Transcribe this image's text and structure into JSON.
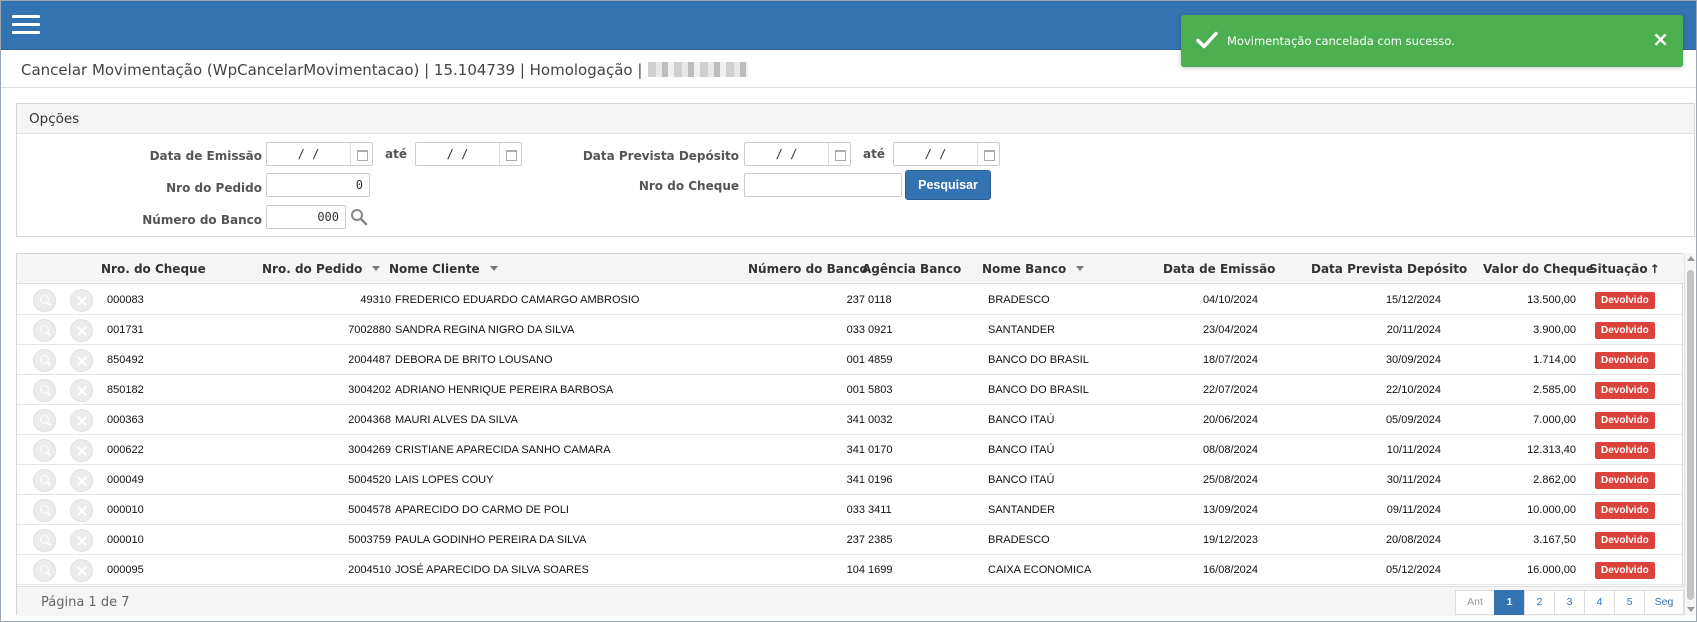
{
  "toast": {
    "message": "Movimentação cancelada com sucesso.",
    "close_label": "×",
    "color": "#4caf50"
  },
  "header": {
    "title": "Cancelar Movimentação (WpCancelarMovimentacao) | 15.104739 | Homologação |",
    "color": "#3473b1"
  },
  "options": {
    "panel_title": "Opções",
    "labels": {
      "data_emissao": "Data de Emissão",
      "ate1": "até",
      "data_prevista": "Data Prevista Depósito",
      "ate2": "até",
      "nro_pedido": "Nro do Pedido",
      "nro_cheque": "Nro do Cheque",
      "numero_banco": "Número do Banco"
    },
    "values": {
      "data_emissao_de": " /  / ",
      "data_emissao_ate": " /  / ",
      "data_prevista_de": " /  / ",
      "data_prevista_ate": " /  / ",
      "nro_pedido": "0",
      "nro_cheque": "",
      "numero_banco": "000"
    },
    "search_button": "Pesquisar"
  },
  "table": {
    "columns": {
      "nro_cheque": "Nro. do Cheque",
      "nro_pedido": "Nro. do Pedido",
      "nome_cliente": "Nome Cliente",
      "numero_banco": "Número do Banco",
      "agencia": "Agência Banco",
      "nome_banco": "Nome Banco",
      "data_emissao": "Data de Emissão",
      "data_prevista": "Data Prevista Depósito",
      "valor": "Valor do Cheque",
      "situacao": "Situação"
    },
    "sort_arrow": "↑",
    "rows": [
      {
        "cheque": "000083",
        "pedido": "49310",
        "cliente": "FREDERICO EDUARDO CAMARGO AMBROSIO",
        "nbanco": "237",
        "agencia": "0118",
        "banco": "BRADESCO",
        "emissao": "04/10/2024",
        "prevista": "15/12/2024",
        "valor": "13.500,00",
        "situacao": "Devolvido"
      },
      {
        "cheque": "001731",
        "pedido": "7002880",
        "cliente": "SANDRA REGINA NIGRO DA SILVA",
        "nbanco": "033",
        "agencia": "0921",
        "banco": "SANTANDER",
        "emissao": "23/04/2024",
        "prevista": "20/11/2024",
        "valor": "3.900,00",
        "situacao": "Devolvido"
      },
      {
        "cheque": "850492",
        "pedido": "2004487",
        "cliente": "DEBORA DE BRITO LOUSANO",
        "nbanco": "001",
        "agencia": "4859",
        "banco": "BANCO DO BRASIL",
        "emissao": "18/07/2024",
        "prevista": "30/09/2024",
        "valor": "1.714,00",
        "situacao": "Devolvido"
      },
      {
        "cheque": "850182",
        "pedido": "3004202",
        "cliente": "ADRIANO HENRIQUE PEREIRA BARBOSA",
        "nbanco": "001",
        "agencia": "5803",
        "banco": "BANCO DO BRASIL",
        "emissao": "22/07/2024",
        "prevista": "22/10/2024",
        "valor": "2.585,00",
        "situacao": "Devolvido"
      },
      {
        "cheque": "000363",
        "pedido": "2004368",
        "cliente": "MAURI ALVES DA SILVA",
        "nbanco": "341",
        "agencia": "0032",
        "banco": "BANCO ITAÚ",
        "emissao": "20/06/2024",
        "prevista": "05/09/2024",
        "valor": "7.000,00",
        "situacao": "Devolvido"
      },
      {
        "cheque": "000622",
        "pedido": "3004269",
        "cliente": "CRISTIANE APARECIDA SANHO CAMARA",
        "nbanco": "341",
        "agencia": "0170",
        "banco": "BANCO ITAÚ",
        "emissao": "08/08/2024",
        "prevista": "10/11/2024",
        "valor": "12.313,40",
        "situacao": "Devolvido"
      },
      {
        "cheque": "000049",
        "pedido": "5004520",
        "cliente": "LAIS LOPES COUY",
        "nbanco": "341",
        "agencia": "0196",
        "banco": "BANCO ITAÚ",
        "emissao": "25/08/2024",
        "prevista": "30/11/2024",
        "valor": "2.862,00",
        "situacao": "Devolvido"
      },
      {
        "cheque": "000010",
        "pedido": "5004578",
        "cliente": "APARECIDO DO CARMO DE POLI",
        "nbanco": "033",
        "agencia": "3411",
        "banco": "SANTANDER",
        "emissao": "13/09/2024",
        "prevista": "09/11/2024",
        "valor": "10.000,00",
        "situacao": "Devolvido"
      },
      {
        "cheque": "000010",
        "pedido": "5003759",
        "cliente": "PAULA GODINHO PEREIRA DA SILVA",
        "nbanco": "237",
        "agencia": "2385",
        "banco": "BRADESCO",
        "emissao": "19/12/2023",
        "prevista": "20/08/2024",
        "valor": "3.167,50",
        "situacao": "Devolvido"
      },
      {
        "cheque": "000095",
        "pedido": "2004510",
        "cliente": "JOSÉ APARECIDO DA SILVA SOARES",
        "nbanco": "104",
        "agencia": "1699",
        "banco": "CAIXA ECONOMICA",
        "emissao": "16/08/2024",
        "prevista": "05/12/2024",
        "valor": "16.000,00",
        "situacao": "Devolvido"
      }
    ],
    "status_color": "#d9433b"
  },
  "footer": {
    "page_info": "Página 1 de 7",
    "prev": "Ant",
    "pages": [
      "1",
      "2",
      "3",
      "4",
      "5"
    ],
    "next": "Seg"
  }
}
